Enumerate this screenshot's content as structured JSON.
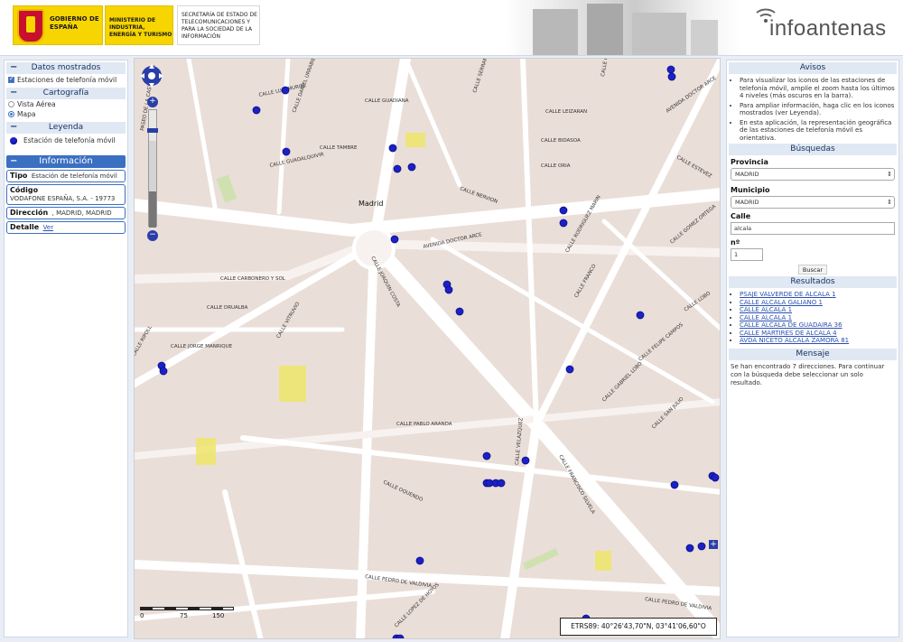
{
  "header": {
    "gobierno": "GOBIERNO DE ESPAÑA",
    "ministerio": "MINISTERIO DE INDUSTRIA, ENERGÍA Y TURISMO",
    "secretaria": "SECRETARÍA DE ESTADO DE TELECOMUNICACIONES Y PARA LA SOCIEDAD DE LA INFORMACIÓN",
    "brand": "infoantenas"
  },
  "left": {
    "datos_title": "Datos mostrados",
    "datos_item": "Estaciones de telefonía móvil",
    "cartografia_title": "Cartografía",
    "vista_aerea": "Vista Aérea",
    "mapa": "Mapa",
    "leyenda_title": "Leyenda",
    "leyenda_item": "Estación de telefonía móvil",
    "informacion_title": "Información",
    "tipo_label": "Tipo",
    "tipo_value": "Estación de telefonía móvil",
    "codigo_label": "Código",
    "codigo_value": "VODAFONE ESPAÑA, S.A. - 19773",
    "direccion_label": "Dirección",
    "direccion_value": ", MADRID, MADRID",
    "detalle_label": "Detalle",
    "detalle_link": "Ver",
    "collapse": "−"
  },
  "map": {
    "coords": "ETRS89: 40°26'43,70\"N, 03°41'06,60\"O",
    "scale": [
      "0",
      "75",
      "150"
    ],
    "plus": "+",
    "minus": "−",
    "streets": [
      "CALLE LUIS MURIEL",
      "CALLE DANIEL URRABIETA",
      "CALLE GUADIANA",
      "CALLE TAMBRE",
      "CALLE GUADALQUIVIR",
      "CALLE SERRANO",
      "CALLE LEIZARAN",
      "CALLE BIDASOA",
      "CALLE ORIA",
      "CALLE NERVION",
      "AVENIDA DOCTOR ARCE",
      "CALLE JOAQUIN COSTA",
      "CALLE CARBONERO Y SOL",
      "CALLE DRUALBA",
      "CALLE JORGE MANRIQUE",
      "CALLE VITRUVIO",
      "CALLE PABLO ARANDA",
      "CALLE VELAZQUEZ",
      "CALLE OQUENDO",
      "CALLE FRANCISCO SILVELA",
      "CALLE PEDRO DE VALDIVIA",
      "CALLE LOPEZ DE HOYOS",
      "AVENIDA DOCTOR ARCE",
      "CALLE GOMEZ ORTEGA",
      "CALLE RODRIGUEZ MARIN",
      "CALLE FRANCO",
      "CALLE LOBO",
      "CALLE FELIPE CAMPOS",
      "CALLE GABRIEL LOBO",
      "CALLE SAN JULIO",
      "CALLE ESTEVEZ",
      "CALLE GENIL",
      "CALLE RIPOLL",
      "PASEO DE LA CASTELLANA",
      "CALLE PEDRO DE VALDIVIA",
      "Madrid"
    ]
  },
  "right": {
    "avisos_title": "Avisos",
    "avisos": [
      "Para visualizar los iconos de las estaciones de telefonía móvil, amplíe el zoom hasta los últimos 4 niveles (más oscuros en la barra).",
      "Para ampliar información, haga clic en los iconos mostrados (ver Leyenda).",
      "En esta aplicación, la representación geográfica de las estaciones de telefonía móvil es orientativa."
    ],
    "busquedas_title": "Búsquedas",
    "provincia_label": "Provincia",
    "provincia_value": "MADRID",
    "municipio_label": "Municipio",
    "municipio_value": "MADRID",
    "calle_label": "Calle",
    "calle_value": "alcala",
    "numero_label": "nº",
    "numero_value": "1",
    "buscar": "Buscar",
    "resultados_title": "Resultados",
    "resultados": [
      "PSAJE VALVERDE DE ALCALA 1",
      "CALLE ALCALA GALIANO 1",
      "CALLE ALCALA 1",
      "CALLE ALCALA 1",
      "CALLE ALCALA DE GUADAIRA 36",
      "CALLE MARTIRES DE ALCALA 4",
      "AVDA NICETO ALCALA ZAMORA 81"
    ],
    "mensaje_title": "Mensaje",
    "mensaje": "Se han encontrado 7 direcciones. Para continuar con la búsqueda debe seleccionar un solo resultado."
  },
  "colors": {
    "accent": "#3b6fc2",
    "antenna": "#1c21c4",
    "map_bg": "#eaded8"
  },
  "icons": [
    "antenna-icon",
    "pan-icon",
    "zoom-in-icon",
    "zoom-out-icon",
    "plus-icon"
  ]
}
